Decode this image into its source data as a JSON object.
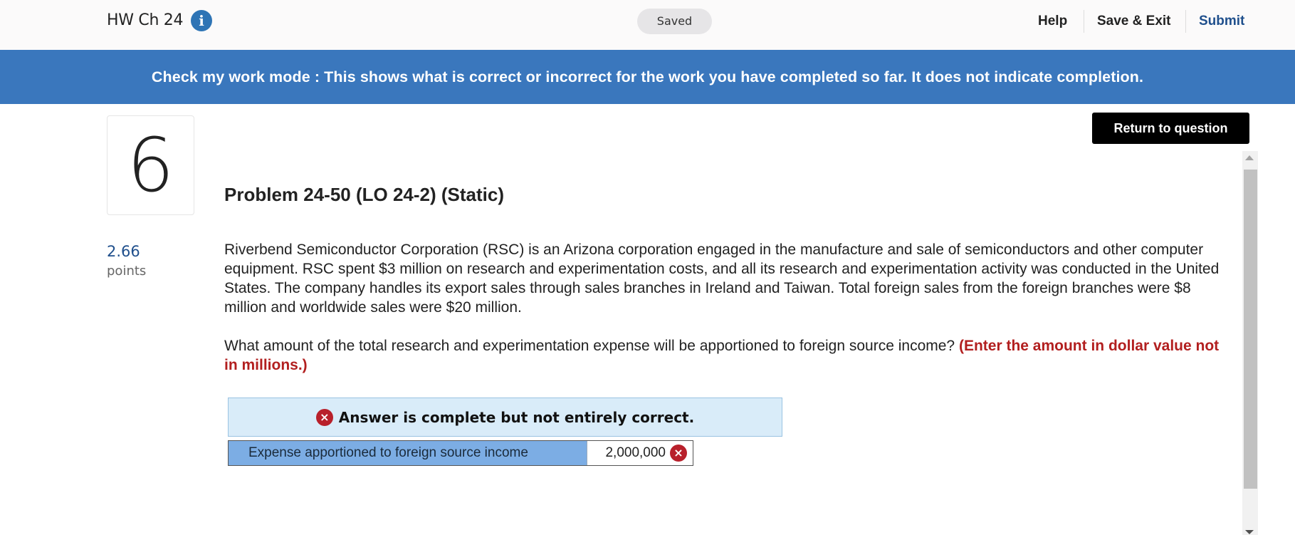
{
  "header": {
    "title": "HW Ch 24",
    "info_icon": "i",
    "saved_label": "Saved",
    "nav": {
      "help": "Help",
      "save_exit": "Save & Exit",
      "submit": "Submit"
    }
  },
  "banner": {
    "text": "Check my work mode : This shows what is correct or incorrect for the work you have completed so far. It does not indicate completion."
  },
  "return_button_label": "Return to question",
  "question": {
    "number": "6",
    "points_value": "2.66",
    "points_label": "points",
    "title": "Problem 24-50 (LO 24-2) (Static)",
    "body": "Riverbend Semiconductor Corporation (RSC) is an Arizona corporation engaged in the manufacture and sale of semiconductors and other computer equipment. RSC spent $3 million on research and experimentation costs, and all its research and experimentation activity was conducted in the United States. The company handles its export sales through sales branches in Ireland and Taiwan. Total foreign sales from the foreign branches were $8 million and worldwide sales were $20 million.",
    "prompt": "What amount of the total research and experimentation expense will be apportioned to foreign source income?",
    "prompt_note": "(Enter the amount in dollar value not in millions.)"
  },
  "answer": {
    "status": "Answer is complete but not entirely correct.",
    "status_icon": "×",
    "row_label": "Expense apportioned to foreign source income",
    "row_value": "2,000,000",
    "row_icon": "×"
  },
  "colors": {
    "banner": "#3a77bd",
    "submit": "#1f4f8c",
    "error": "#b8202b",
    "answer_label_bg": "#7cade4",
    "status_bg": "#d9ecf9"
  }
}
